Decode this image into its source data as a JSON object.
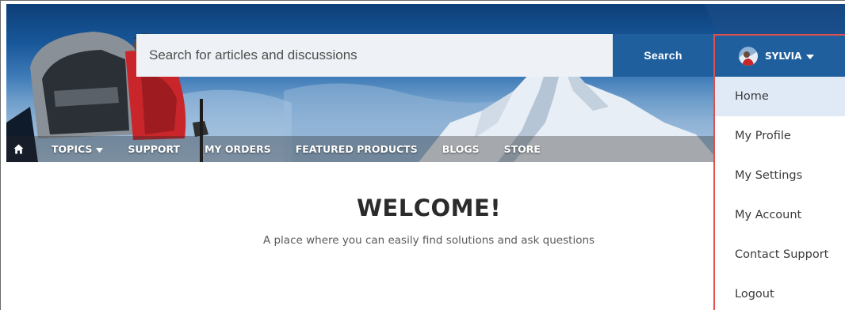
{
  "search": {
    "placeholder": "Search for articles and discussions",
    "button_label": "Search"
  },
  "nav": {
    "home_icon": "home-icon",
    "items": [
      {
        "label": "TOPICS",
        "has_dropdown": true
      },
      {
        "label": "SUPPORT"
      },
      {
        "label": "MY ORDERS"
      },
      {
        "label": "FEATURED PRODUCTS"
      },
      {
        "label": "BLOGS"
      },
      {
        "label": "STORE"
      }
    ]
  },
  "user_menu": {
    "name": "SYLVIA",
    "items": [
      {
        "label": "Home",
        "active": true
      },
      {
        "label": "My Profile"
      },
      {
        "label": "My Settings"
      },
      {
        "label": "My Account"
      },
      {
        "label": "Contact Support"
      },
      {
        "label": "Logout"
      }
    ]
  },
  "welcome": {
    "title": "WELCOME!",
    "subtitle": "A place where you can easily find solutions and ask questions"
  },
  "colors": {
    "accent": "#1f5f9e",
    "highlight_border": "#e0504f",
    "active_menu_bg": "#dfeaf6"
  }
}
